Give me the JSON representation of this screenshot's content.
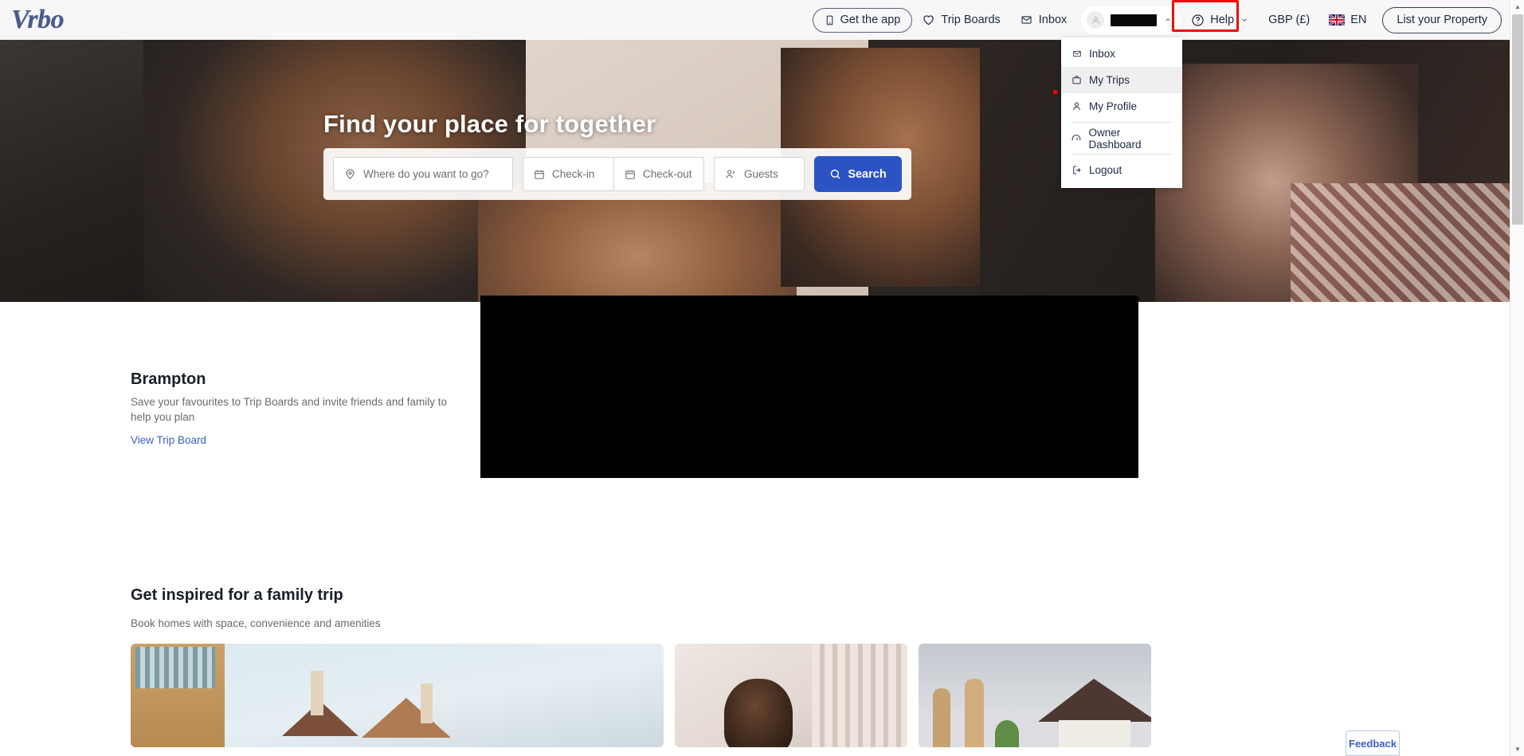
{
  "brand": {
    "logo_text": "Vrbo",
    "logo_color": "#4a5a8a"
  },
  "header": {
    "get_app": "Get the app",
    "trip_boards": "Trip Boards",
    "inbox": "Inbox",
    "account_name_redacted": "",
    "help": "Help",
    "currency": "GBP (£)",
    "language": "EN",
    "list_property": "List your Property",
    "icons": {
      "get_app": "mobile-icon",
      "trip_boards": "heart-icon",
      "inbox": "envelope-icon",
      "account": "user-avatar-icon",
      "account_chevron": "chevron-up-icon",
      "help": "question-circle-icon",
      "help_chevron": "chevron-down-icon",
      "flag": "uk-flag-icon"
    },
    "help_highlight_color": "#ef0c0c"
  },
  "account_menu": {
    "items": [
      {
        "label": "Inbox",
        "icon": "envelope-icon",
        "active": false,
        "separator_after": false
      },
      {
        "label": "My Trips",
        "icon": "suitcase-icon",
        "active": true,
        "separator_after": false
      },
      {
        "label": "My Profile",
        "icon": "person-icon",
        "active": false,
        "separator_after": true
      },
      {
        "label": "Owner Dashboard",
        "icon": "speedometer-icon",
        "active": false,
        "separator_after": true
      },
      {
        "label": "Logout",
        "icon": "logout-icon",
        "active": false,
        "separator_after": false
      }
    ]
  },
  "hero": {
    "title": "Find your place for together",
    "search": {
      "destination_placeholder": "Where do you want to go?",
      "checkin_placeholder": "Check-in",
      "checkout_placeholder": "Check-out",
      "guests_placeholder": "Guests",
      "search_label": "Search",
      "search_button_color": "#2b53c4",
      "icons": {
        "destination": "map-pin-icon",
        "checkin": "calendar-icon",
        "checkout": "calendar-icon",
        "guests": "guests-icon",
        "search": "search-icon"
      }
    }
  },
  "trip_board": {
    "title": "Brampton",
    "description": "Save your favourites to Trip Boards and invite friends and family to help you plan",
    "link": "View Trip Board",
    "link_color": "#3a5fc4"
  },
  "inspire": {
    "title": "Get inspired for a family trip",
    "subtitle": "Book homes with space, convenience and amenities",
    "cards": [
      {
        "name": "city-homes-card"
      },
      {
        "name": "pet-friendly-card"
      },
      {
        "name": "family-homes-card"
      }
    ]
  },
  "feedback": {
    "label": "Feedback",
    "color": "#3a5fc4"
  },
  "scrollbar": {
    "up": "▲",
    "down": "▼"
  }
}
